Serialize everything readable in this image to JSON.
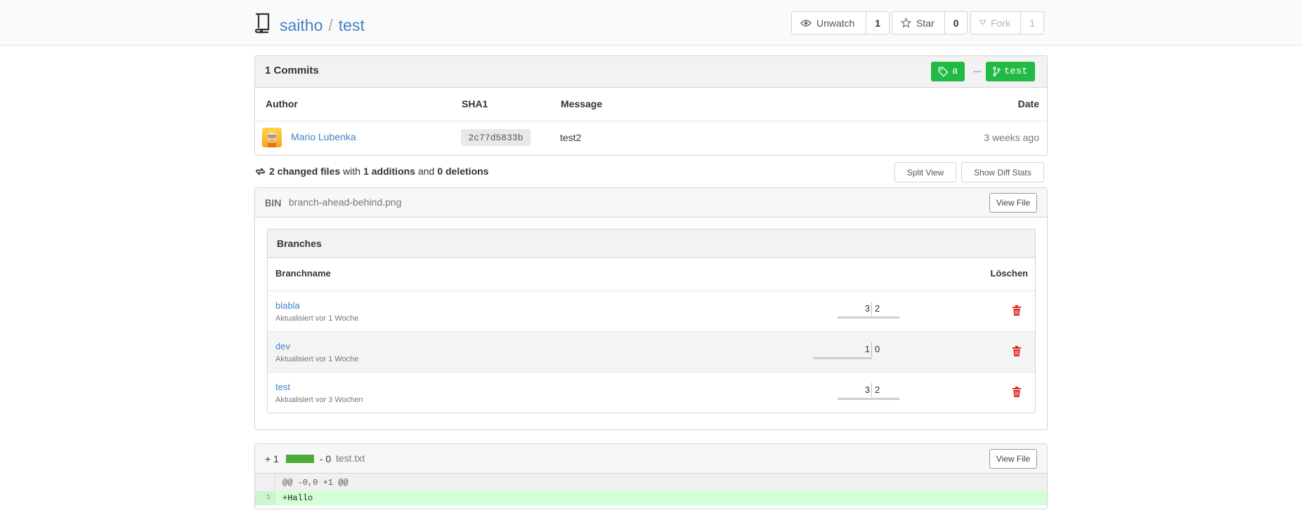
{
  "repo": {
    "owner": "saitho",
    "separator": "/",
    "name": "test"
  },
  "actions": {
    "watch": {
      "label": "Unwatch",
      "count": "1"
    },
    "star": {
      "label": "Star",
      "count": "0"
    },
    "fork": {
      "label": "Fork",
      "count": "1"
    }
  },
  "commits": {
    "title": "1 Commits",
    "tag_label": "a",
    "ellipsis": "...",
    "branch_label": "test",
    "columns": {
      "author": "Author",
      "sha": "SHA1",
      "message": "Message",
      "date": "Date"
    },
    "rows": [
      {
        "author": "Mario Lubenka",
        "sha": "2c77d5833b",
        "message": "test2",
        "date": "3 weeks ago"
      }
    ]
  },
  "diff_summary": {
    "changed": "2 changed files",
    "with": "with",
    "additions": "1 additions",
    "and": "and",
    "deletions": "0 deletions",
    "split_view": "Split View",
    "show_diff_stats": "Show Diff Stats"
  },
  "file1": {
    "kind": "BIN",
    "name": "branch-ahead-behind.png",
    "view_file": "View File",
    "image": {
      "title": "Branches",
      "col_name": "Branchname",
      "col_delete": "Löschen",
      "branches": [
        {
          "name": "blabla",
          "updated": "Aktualisiert vor 1 Woche",
          "ahead": "3",
          "behind": "2"
        },
        {
          "name": "dev",
          "updated": "Aktualisiert vor 1 Woche",
          "ahead": "1",
          "behind": "0"
        },
        {
          "name": "test",
          "updated": "Aktualisiert vor 3 Wochen",
          "ahead": "3",
          "behind": "2"
        }
      ]
    }
  },
  "file2": {
    "additions": "+ 1",
    "deletions": "- 0",
    "name": "test.txt",
    "view_file": "View File",
    "hunk": "@@ -0,0 +1 @@",
    "lines": [
      {
        "num": "1",
        "code": "+Hallo"
      }
    ]
  },
  "colors": {
    "accent": "#21ba45",
    "link": "#4183c4",
    "delete": "#db2828",
    "added_line": "#d1ffd6"
  }
}
